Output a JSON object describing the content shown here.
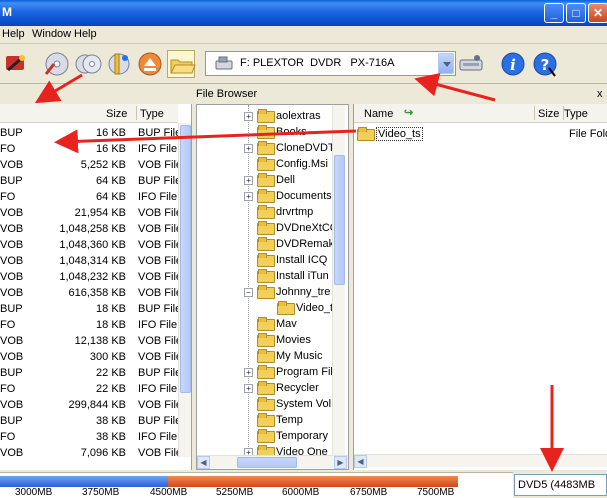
{
  "window": {
    "title": "M",
    "minimize_glyph": "_",
    "maximize_glyph": "□",
    "close_glyph": "✕"
  },
  "menu": {
    "items": [
      "Help",
      "Window",
      "Help"
    ]
  },
  "menubar": {
    "window": "Window",
    "help": "Help"
  },
  "toolbar": {
    "drive": "F: PLEXTOR  DVDR   PX-716A",
    "icons": [
      "burn-wizard-icon",
      "disc-write-icon",
      "disc-copy-icon",
      "disc-info-icon",
      "eject-icon",
      "open-folder-icon",
      "drive-settings-icon",
      "info-icon",
      "help-icon"
    ]
  },
  "panel": {
    "title": "File Browser",
    "close": "x"
  },
  "left_list": {
    "headers": {
      "size": "Size",
      "type": "Type"
    },
    "rows": [
      {
        "name": "BUP",
        "size": "16 KB",
        "type": "BUP File"
      },
      {
        "name": "FO",
        "size": "16 KB",
        "type": "IFO File"
      },
      {
        "name": "VOB",
        "size": "5,252 KB",
        "type": "VOB File"
      },
      {
        "name": "BUP",
        "size": "64 KB",
        "type": "BUP File"
      },
      {
        "name": "FO",
        "size": "64 KB",
        "type": "IFO File"
      },
      {
        "name": "VOB",
        "size": "21,954 KB",
        "type": "VOB File"
      },
      {
        "name": "VOB",
        "size": "1,048,258 KB",
        "type": "VOB File"
      },
      {
        "name": "VOB",
        "size": "1,048,360 KB",
        "type": "VOB File"
      },
      {
        "name": "VOB",
        "size": "1,048,314 KB",
        "type": "VOB File"
      },
      {
        "name": "VOB",
        "size": "1,048,232 KB",
        "type": "VOB File"
      },
      {
        "name": "VOB",
        "size": "616,358 KB",
        "type": "VOB File"
      },
      {
        "name": "BUP",
        "size": "18 KB",
        "type": "BUP File"
      },
      {
        "name": "FO",
        "size": "18 KB",
        "type": "IFO File"
      },
      {
        "name": "VOB",
        "size": "12,138 KB",
        "type": "VOB File"
      },
      {
        "name": "VOB",
        "size": "300 KB",
        "type": "VOB File"
      },
      {
        "name": "BUP",
        "size": "22 KB",
        "type": "BUP File"
      },
      {
        "name": "FO",
        "size": "22 KB",
        "type": "IFO File"
      },
      {
        "name": "VOB",
        "size": "299,844 KB",
        "type": "VOB File"
      },
      {
        "name": "BUP",
        "size": "38 KB",
        "type": "BUP File"
      },
      {
        "name": "FO",
        "size": "38 KB",
        "type": "IFO File"
      },
      {
        "name": "VOB",
        "size": "7,096 KB",
        "type": "VOB File"
      }
    ]
  },
  "tree": {
    "items": [
      {
        "label": "aolextras",
        "expandable": true
      },
      {
        "label": "Books",
        "expandable": false
      },
      {
        "label": "CloneDVDT",
        "expandable": true
      },
      {
        "label": "Config.Msi",
        "expandable": false
      },
      {
        "label": "Dell",
        "expandable": true
      },
      {
        "label": "Documents",
        "expandable": true
      },
      {
        "label": "drvrtmp",
        "expandable": false
      },
      {
        "label": "DVDneXtCO",
        "expandable": false
      },
      {
        "label": "DVDRemak",
        "expandable": false
      },
      {
        "label": "Install ICQ",
        "expandable": false
      },
      {
        "label": "Install iTun",
        "expandable": false
      },
      {
        "label": "Johnny_tre",
        "expandable": true,
        "expanded": true
      },
      {
        "label": "Video_t",
        "expandable": false,
        "child": true
      },
      {
        "label": "Mav",
        "expandable": false
      },
      {
        "label": "Movies",
        "expandable": false
      },
      {
        "label": "My Music",
        "expandable": false
      },
      {
        "label": "Program Fil",
        "expandable": true
      },
      {
        "label": "Recycler",
        "expandable": true
      },
      {
        "label": "System Vol",
        "expandable": false
      },
      {
        "label": "Temp",
        "expandable": false
      },
      {
        "label": "Temporary",
        "expandable": false
      },
      {
        "label": "Video One",
        "expandable": true
      }
    ]
  },
  "right_list": {
    "headers": {
      "name": "Name",
      "size": "Size",
      "type": "Type"
    },
    "rows": [
      {
        "name": "Video_ts",
        "type": "File Fold"
      }
    ]
  },
  "capacity": {
    "ticks": [
      "3000MB",
      "3750MB",
      "4500MB",
      "5250MB",
      "6000MB",
      "6750MB",
      "7500MB"
    ],
    "disc_type": "DVD5 (4483MB"
  },
  "colors": {
    "annotation_arrow": "#e8231e",
    "title_bar": "#0b50cf",
    "capacity_used": "#2a62d5",
    "capacity_over": "#d04a18"
  }
}
